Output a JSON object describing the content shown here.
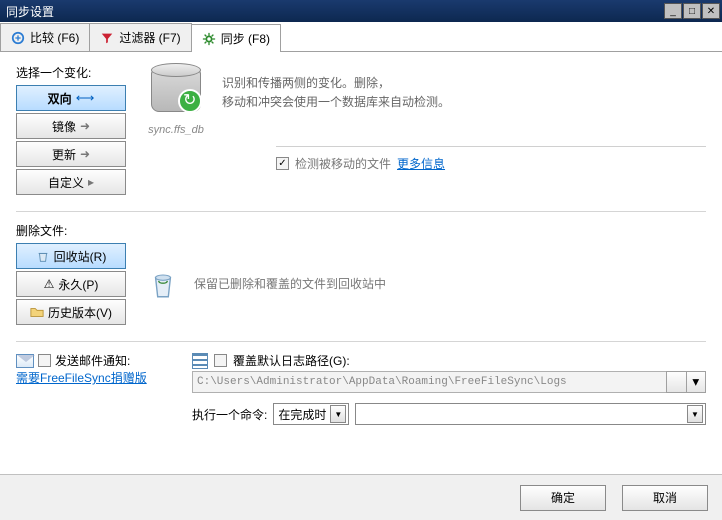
{
  "window": {
    "title": "同步设置"
  },
  "tabs": {
    "compare": "比较 (F6)",
    "filter": "过滤器 (F7)",
    "sync": "同步 (F8)"
  },
  "chooseVariant": {
    "label": "选择一个变化:",
    "twoWay": "双向",
    "mirror": "镜像",
    "update": "更新",
    "custom": "自定义"
  },
  "database": {
    "line1": "识别和传播两侧的变化。删除，",
    "line2": "移动和冲突会使用一个数据库来自动检测。",
    "file": "sync.ffs_db"
  },
  "detect": {
    "label": "检测被移动的文件",
    "more": "更多信息"
  },
  "delete": {
    "label": "删除文件:",
    "recycle": "回收站(R)",
    "permanent": "永久(P)",
    "versioning": "历史版本(V)",
    "desc": "保留已删除和覆盖的文件到回收站中"
  },
  "email": {
    "label": "发送邮件通知:",
    "donate": "需要FreeFileSync捐赠版"
  },
  "log": {
    "override": "覆盖默认日志路径(G):",
    "path": "C:\\Users\\Administrator\\AppData\\Roaming\\FreeFileSync\\Logs"
  },
  "command": {
    "label": "执行一个命令:",
    "when": "在完成时"
  },
  "buttons": {
    "ok": "确定",
    "cancel": "取消"
  }
}
